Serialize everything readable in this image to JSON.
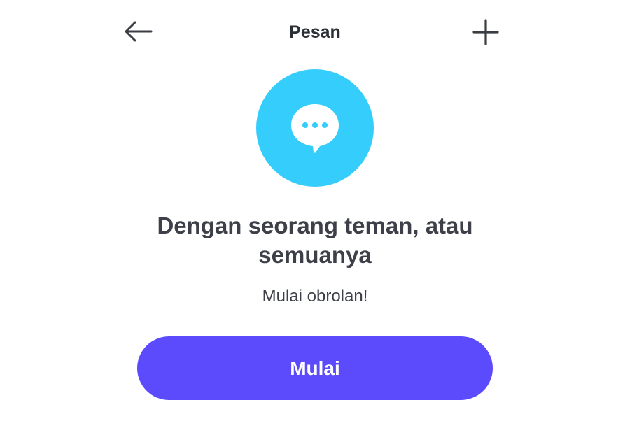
{
  "header": {
    "title": "Pesan",
    "back_icon": "arrow-left-icon",
    "add_icon": "plus-icon"
  },
  "hero": {
    "icon": "chat-bubble-icon",
    "circle_color": "#35CDFB"
  },
  "content": {
    "headline": "Dengan seorang teman, atau semuanya",
    "subtext": "Mulai obrolan!"
  },
  "action": {
    "start_label": "Mulai",
    "button_color": "#5B4BFC"
  }
}
